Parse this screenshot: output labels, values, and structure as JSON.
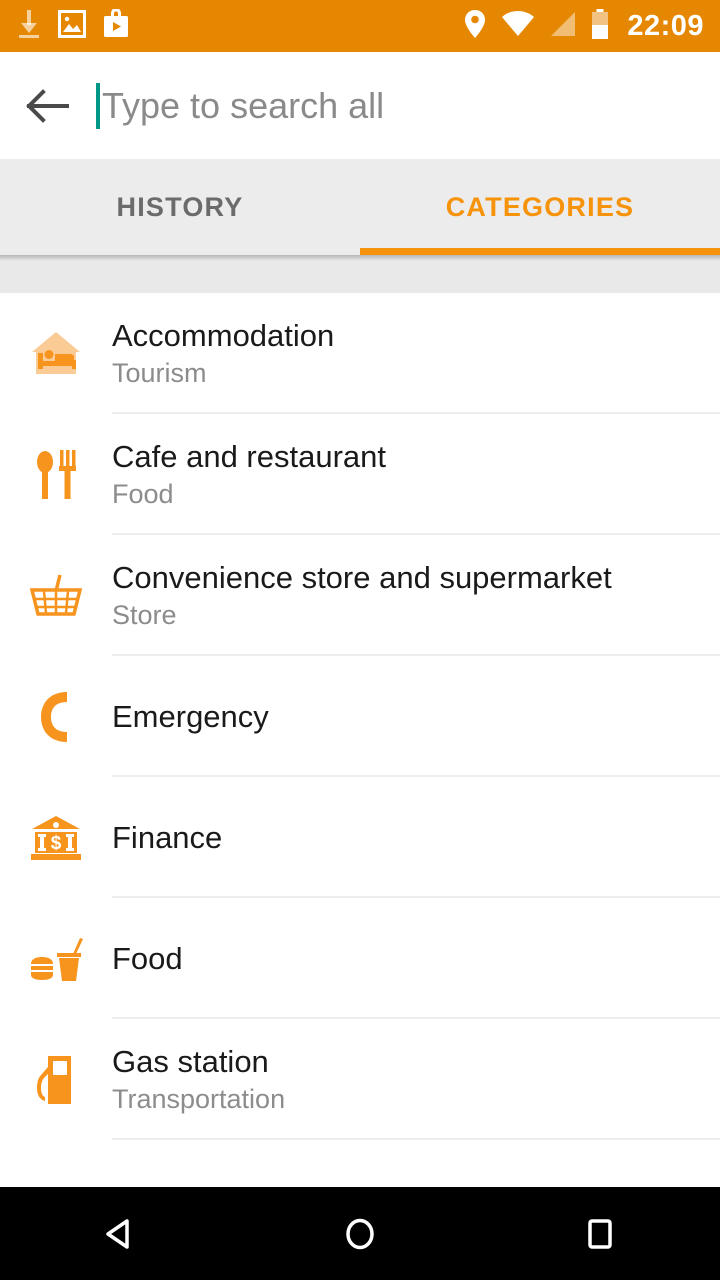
{
  "status_bar": {
    "background_color": "#e58700",
    "time": "22:09",
    "left_icons": [
      {
        "name": "download-icon",
        "label": "download"
      },
      {
        "name": "image-icon",
        "label": "screenshot"
      },
      {
        "name": "play-store-icon",
        "label": "play store"
      }
    ],
    "right_icons": [
      {
        "name": "location-pin-icon",
        "label": "location"
      },
      {
        "name": "wifi-icon",
        "label": "wifi"
      },
      {
        "name": "cell-signal-icon",
        "label": "signal"
      },
      {
        "name": "battery-icon",
        "label": "battery"
      }
    ]
  },
  "search": {
    "back_label": "back",
    "placeholder": "Type to search all",
    "value": "",
    "caret_color": "#009688"
  },
  "tabs": {
    "active_index": 1,
    "accent_color": "#f7930a",
    "items": [
      {
        "label": "HISTORY",
        "name": "tab-history"
      },
      {
        "label": "CATEGORIES",
        "name": "tab-categories"
      }
    ]
  },
  "categories": {
    "icon_color": "#f7941e",
    "items": [
      {
        "title": "Accommodation",
        "subtitle": "Tourism",
        "icon": "bed-house-icon"
      },
      {
        "title": "Cafe and restaurant",
        "subtitle": "Food",
        "icon": "cutlery-icon"
      },
      {
        "title": "Convenience store and supermarket",
        "subtitle": "Store",
        "icon": "shopping-basket-icon"
      },
      {
        "title": "Emergency",
        "subtitle": "",
        "icon": "phone-handset-icon"
      },
      {
        "title": "Finance",
        "subtitle": "",
        "icon": "bank-icon"
      },
      {
        "title": "Food",
        "subtitle": "",
        "icon": "burger-drink-icon"
      },
      {
        "title": "Gas station",
        "subtitle": "Transportation",
        "icon": "fuel-pump-icon"
      }
    ]
  },
  "nav_bar": {
    "buttons": [
      {
        "name": "nav-back-button",
        "label": "back"
      },
      {
        "name": "nav-home-button",
        "label": "home"
      },
      {
        "name": "nav-recents-button",
        "label": "recents"
      }
    ]
  }
}
